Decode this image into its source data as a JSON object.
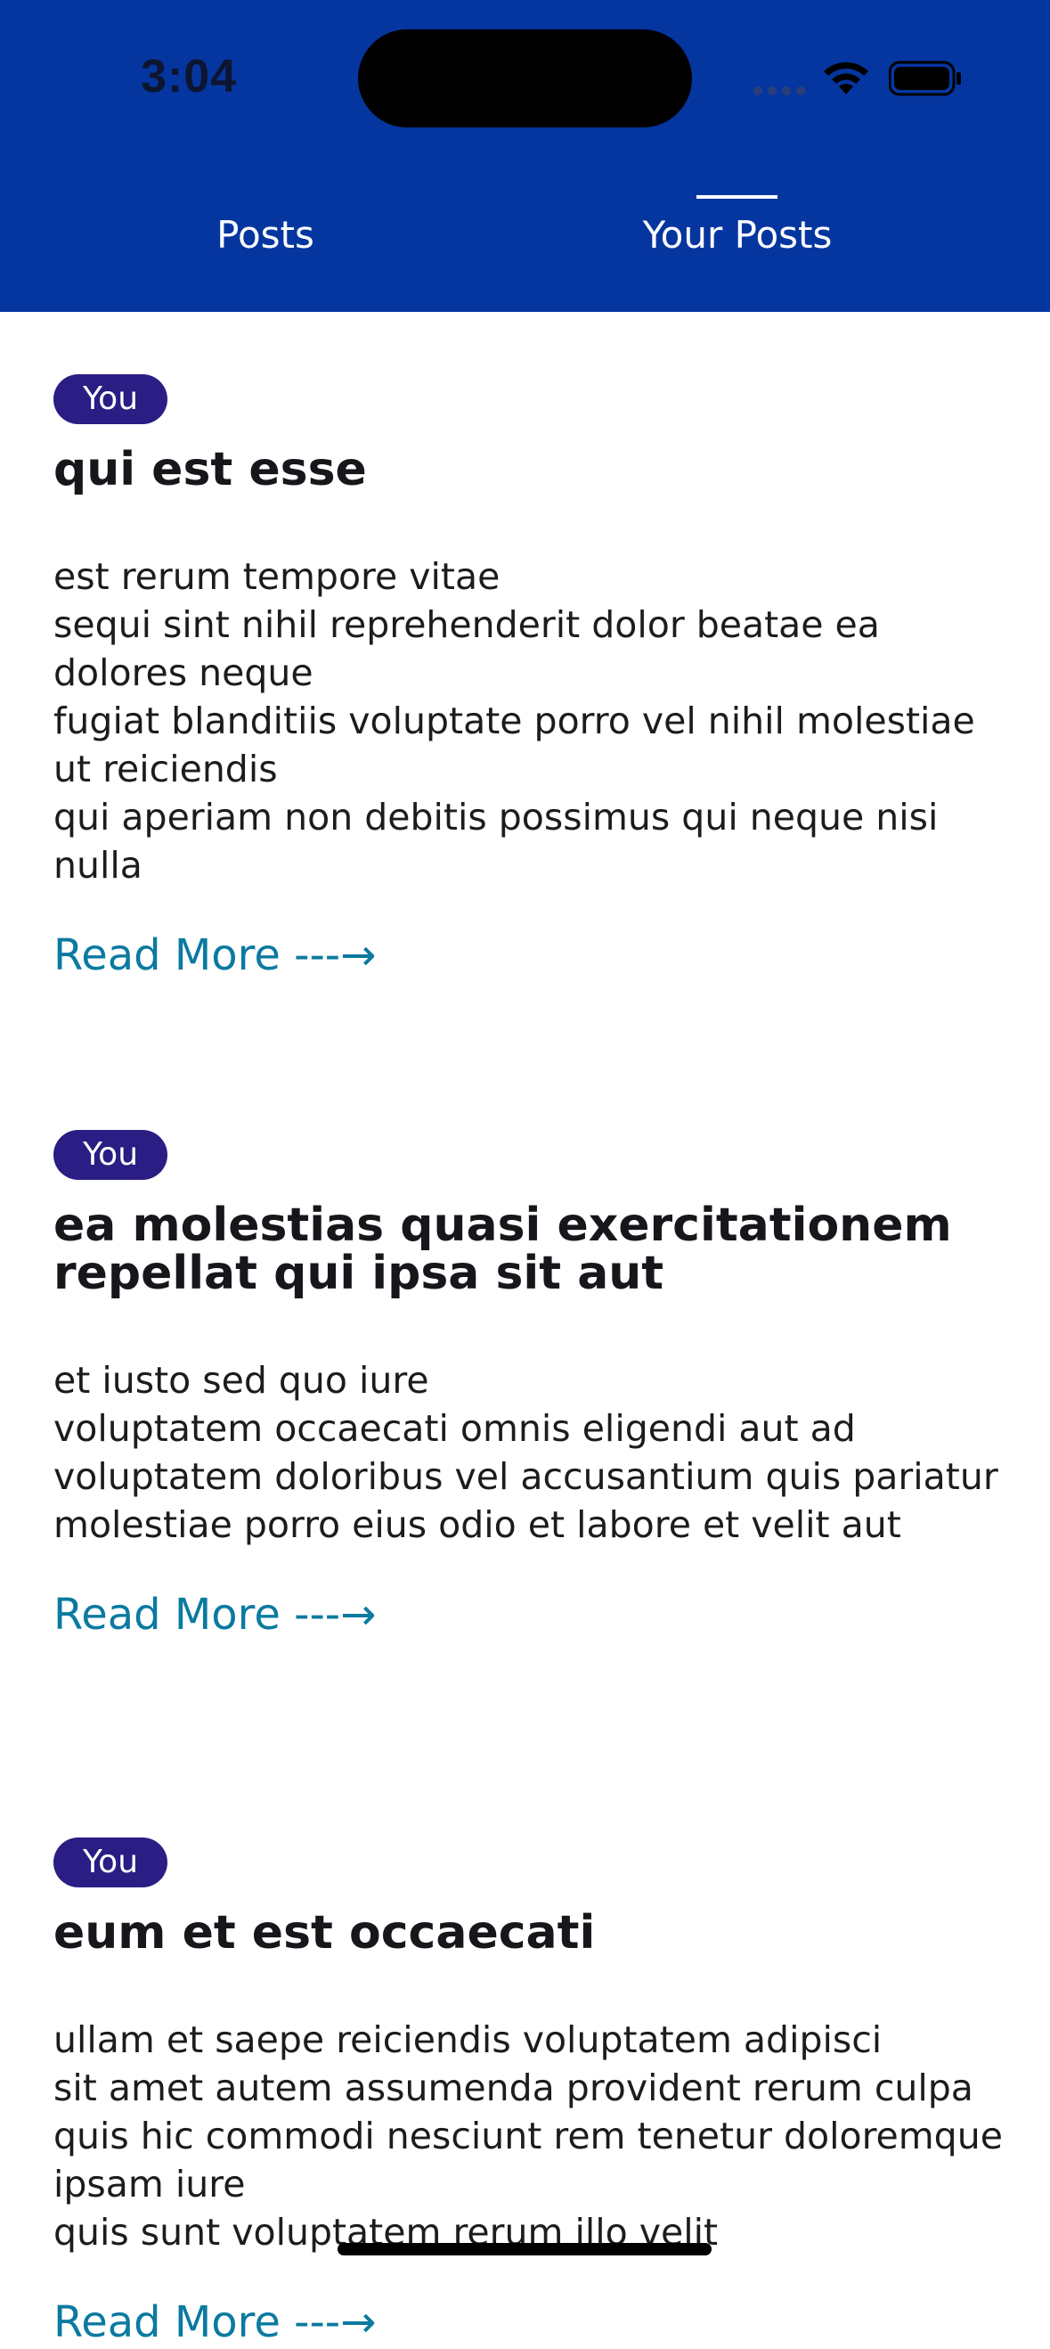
{
  "status_bar": {
    "time": "3:04",
    "icons": [
      "cellular-signal-icon",
      "wifi-icon",
      "battery-icon"
    ]
  },
  "tabs": [
    {
      "label": "Posts",
      "selected": false
    },
    {
      "label": "Your Posts",
      "selected": true
    }
  ],
  "colors": {
    "header_bg": "#0536a0",
    "badge_bg": "#2a1d83",
    "link": "#0b7aa0",
    "text": "#1b1c1e"
  },
  "posts": [
    {
      "badge": "You",
      "title": "qui est esse",
      "body": "est rerum tempore vitae\nsequi sint nihil reprehenderit dolor beatae ea dolores neque\nfugiat blanditiis voluptate porro vel nihil molestiae ut reiciendis\nqui aperiam non debitis possimus qui neque nisi nulla",
      "read_more": "Read More ---→"
    },
    {
      "badge": "You",
      "title": "ea molestias quasi exercitationem repellat qui ipsa sit aut",
      "body": "et iusto sed quo iure\nvoluptatem occaecati omnis eligendi aut ad\nvoluptatem doloribus vel accusantium quis pariatur\nmolestiae porro eius odio et labore et velit aut",
      "read_more": "Read More ---→"
    },
    {
      "badge": "You",
      "title": "eum et est occaecati",
      "body": "ullam et saepe reiciendis voluptatem adipisci\nsit amet autem assumenda provident rerum culpa\nquis hic commodi nesciunt rem tenetur doloremque ipsam iure\nquis sunt voluptatem rerum illo velit",
      "read_more": "Read More ---→"
    }
  ]
}
